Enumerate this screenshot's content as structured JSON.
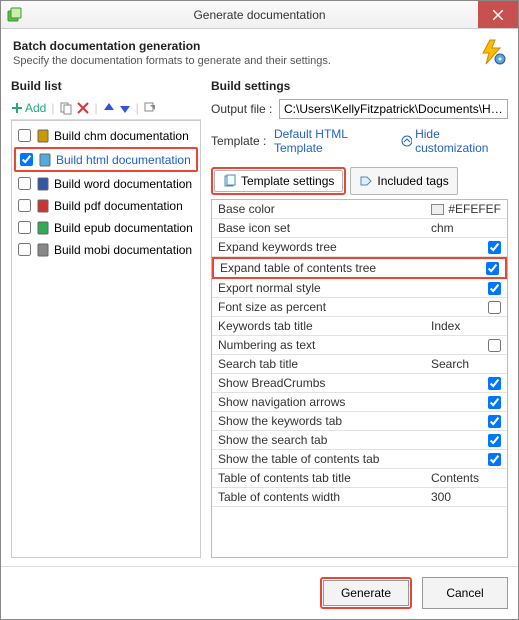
{
  "window": {
    "title": "Generate documentation"
  },
  "header": {
    "title": "Batch documentation generation",
    "subtitle": "Specify the documentation formats to generate and their settings."
  },
  "buildList": {
    "sectionTitle": "Build list",
    "addLabel": "Add",
    "items": [
      {
        "label": "Build chm documentation",
        "checked": false,
        "selected": false
      },
      {
        "label": "Build html documentation",
        "checked": true,
        "selected": true
      },
      {
        "label": "Build word documentation",
        "checked": false,
        "selected": false
      },
      {
        "label": "Build pdf documentation",
        "checked": false,
        "selected": false
      },
      {
        "label": "Build epub documentation",
        "checked": false,
        "selected": false
      },
      {
        "label": "Build mobi documentation",
        "checked": false,
        "selected": false
      }
    ]
  },
  "buildSettings": {
    "sectionTitle": "Build settings",
    "outputFileLabel": "Output file :",
    "outputFilePath": "C:\\Users\\KellyFitzpatrick\\Documents\\HelpNDo…",
    "templateLabel": "Template :",
    "templateValue": "Default HTML Template",
    "hideCustomization": "Hide customization",
    "tabs": {
      "templateSettings": "Template settings",
      "includedTags": "Included tags"
    },
    "rows": [
      {
        "name": "Base color",
        "value": "#EFEFEF",
        "type": "color"
      },
      {
        "name": "Base icon set",
        "value": "chm",
        "type": "text"
      },
      {
        "name": "Expand keywords tree",
        "value": true,
        "type": "check"
      },
      {
        "name": "Expand table of contents tree",
        "value": true,
        "type": "check",
        "highlight": true
      },
      {
        "name": "Export normal style",
        "value": true,
        "type": "check"
      },
      {
        "name": "Font size as percent",
        "value": false,
        "type": "check"
      },
      {
        "name": "Keywords tab title",
        "value": "Index",
        "type": "text"
      },
      {
        "name": "Numbering as text",
        "value": false,
        "type": "check"
      },
      {
        "name": "Search tab title",
        "value": "Search",
        "type": "text"
      },
      {
        "name": "Show BreadCrumbs",
        "value": true,
        "type": "check"
      },
      {
        "name": "Show navigation arrows",
        "value": true,
        "type": "check"
      },
      {
        "name": "Show the keywords tab",
        "value": true,
        "type": "check"
      },
      {
        "name": "Show the search tab",
        "value": true,
        "type": "check"
      },
      {
        "name": "Show the table of contents tab",
        "value": true,
        "type": "check"
      },
      {
        "name": "Table of contents tab title",
        "value": "Contents",
        "type": "text"
      },
      {
        "name": "Table of contents width",
        "value": "300",
        "type": "text"
      }
    ]
  },
  "footer": {
    "generate": "Generate",
    "cancel": "Cancel"
  }
}
